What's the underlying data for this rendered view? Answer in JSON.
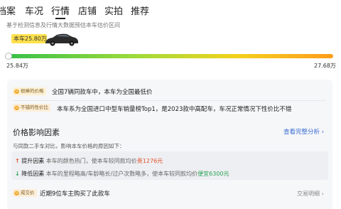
{
  "tabs": [
    "档案",
    "车况",
    "行情",
    "店铺",
    "实拍",
    "推荐"
  ],
  "active_tab": "行情",
  "hint": "基于检测信息及行情大数据预估本车估价区间",
  "car_badge": "本车25.80万",
  "range": {
    "min_label": "25.84万",
    "max_label": "27.68万"
  },
  "insights": [
    {
      "tag": "很棒的价格",
      "text": "全国7辆同款车中，本车为全国最低价"
    },
    {
      "tag": "不错的性价比",
      "text": "本车系为全国进口中型车销量榜Top1，是2023款中高配车，车况正常情况下性价比不错"
    }
  ],
  "factors_section": {
    "title": "价格影响因素",
    "see_all": "查看完整分析",
    "desc": "与同款二手车对比，影响本车价格的原因如下：",
    "up": {
      "label": "提升因素",
      "text": "本车的颜色热门，使本车较同款均价",
      "highlight": "贵1276元"
    },
    "down": {
      "label": "降低因素",
      "text": "本车的里程略高/车龄略长/过户次数略多，使本车较同款均价",
      "highlight": "便宜6300元"
    }
  },
  "deal": {
    "tag": "成交价",
    "text": "近期9位车主购买了此款车",
    "link": "交易明细"
  },
  "colors": {
    "up": "#e0512f",
    "down": "#2aa255",
    "link": "#3a6cd1",
    "badge": "#ffe14c"
  }
}
